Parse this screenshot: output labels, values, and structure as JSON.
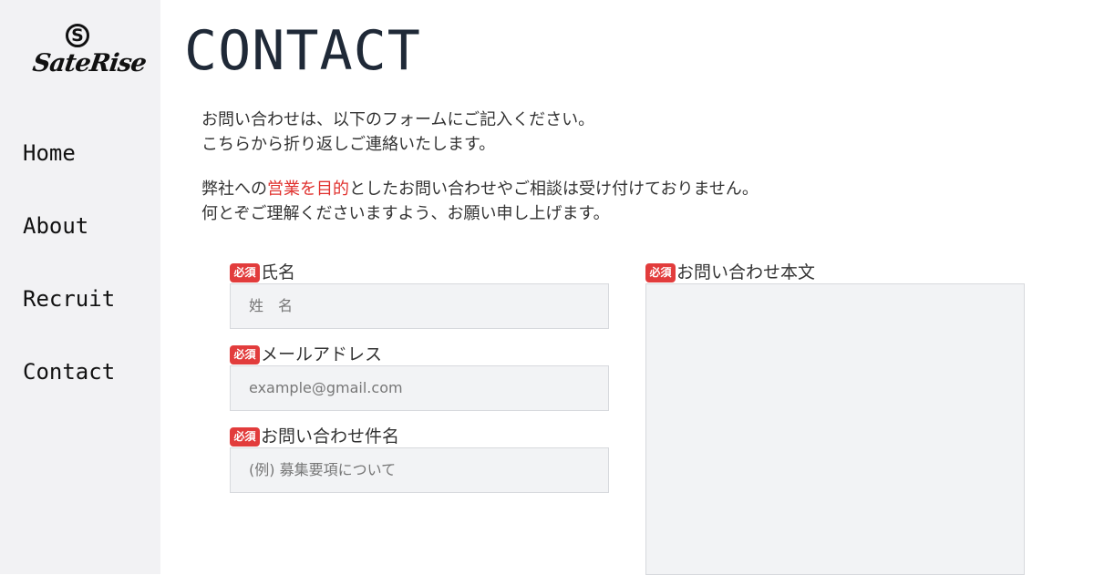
{
  "brand": {
    "logo_mark": "S",
    "logo_text": "SateRise"
  },
  "nav": {
    "items": [
      "Home",
      "About",
      "Recruit",
      "Contact"
    ]
  },
  "page": {
    "title": "CONTACT"
  },
  "intro": {
    "p1_line1": "お問い合わせは、以下のフォームにご記入ください。",
    "p1_line2": "こちらから折り返しご連絡いたします。",
    "p2_pre": "弊社への",
    "p2_highlight": "営業を目的",
    "p2_post": "としたお問い合わせやご相談は受け付けておりません。",
    "p2_line2": "何とぞご理解くださいますよう、お願い申し上げます。"
  },
  "form": {
    "required_badge": "必須",
    "name": {
      "label": "氏名",
      "placeholder": "姓　名"
    },
    "email": {
      "label": "メールアドレス",
      "placeholder": "example@gmail.com"
    },
    "subject": {
      "label": "お問い合わせ件名",
      "placeholder": "(例) 募集要項について"
    },
    "body": {
      "label": "お問い合わせ本文"
    }
  },
  "colors": {
    "sidebar_bg": "#f2f2f4",
    "highlight": "#e0312e",
    "badge": "#e23c3c",
    "input_bg": "#f2f3f5"
  }
}
